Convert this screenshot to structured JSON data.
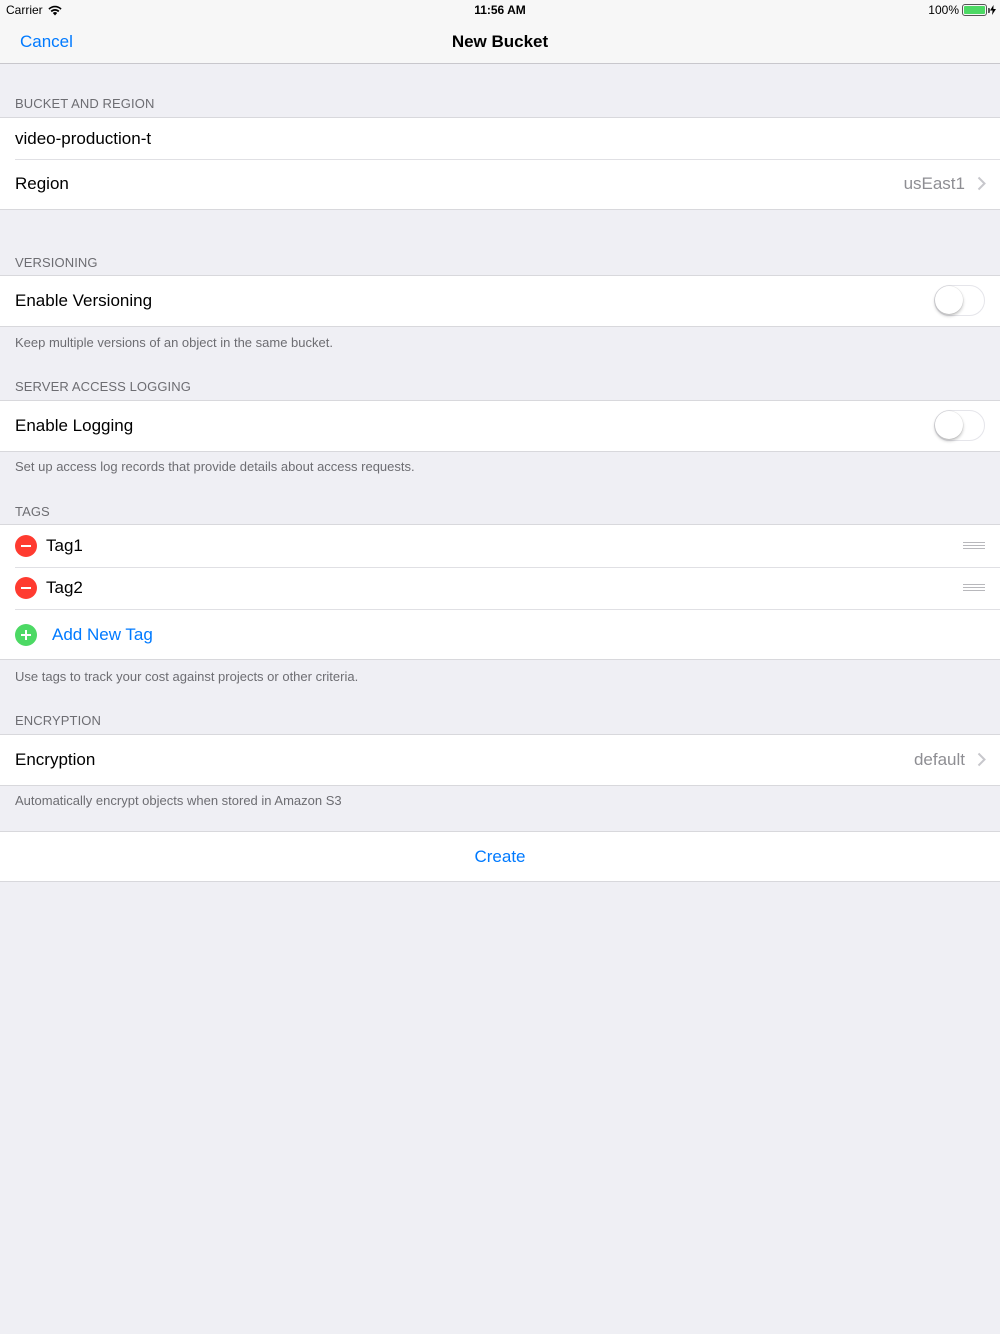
{
  "status_bar": {
    "carrier": "Carrier",
    "time": "11:56 AM",
    "battery": "100%"
  },
  "nav": {
    "cancel": "Cancel",
    "title": "New Bucket"
  },
  "bucket_region": {
    "header": "BUCKET AND REGION",
    "bucket_name": "video-production-t",
    "region_label": "Region",
    "region_value": "usEast1"
  },
  "versioning": {
    "header": "VERSIONING",
    "label": "Enable Versioning",
    "enabled": false,
    "footer": "Keep multiple versions of an object in the same bucket."
  },
  "logging": {
    "header": "SERVER ACCESS LOGGING",
    "label": "Enable Logging",
    "enabled": false,
    "footer": "Set up access log records that provide details about access requests."
  },
  "tags": {
    "header": "TAGS",
    "items": [
      "Tag1",
      "Tag2"
    ],
    "add_label": "Add New Tag",
    "footer": "Use tags to track your cost against projects or other criteria."
  },
  "encryption": {
    "header": "ENCRYPTION",
    "label": "Encryption",
    "value": "default",
    "footer": "Automatically encrypt objects when stored in Amazon S3"
  },
  "create_label": "Create",
  "colors": {
    "accent": "#007aff",
    "delete": "#ff3b30",
    "add": "#4cd964",
    "background": "#efeff4"
  }
}
